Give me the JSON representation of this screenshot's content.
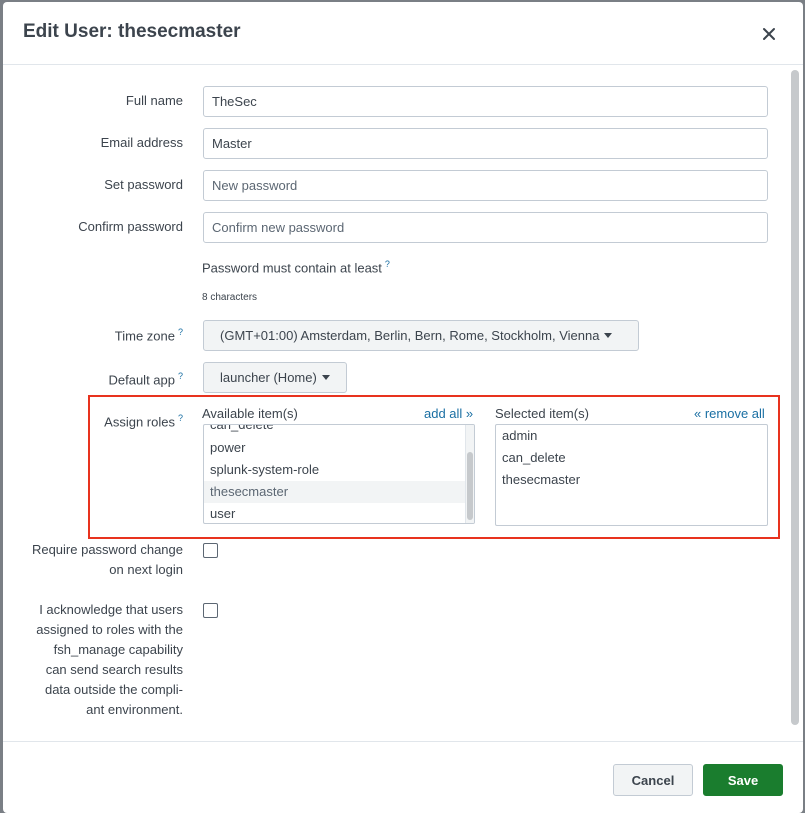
{
  "header": {
    "title": "Edit User: thesecmaster",
    "close_symbol": "×"
  },
  "form": {
    "full_name": {
      "label": "Full name",
      "value": "TheSec"
    },
    "email": {
      "label": "Email address",
      "value": "Master"
    },
    "set_password": {
      "label": "Set password",
      "placeholder": "New password"
    },
    "confirm_password": {
      "label": "Confirm password",
      "placeholder": "Confirm new password"
    },
    "password_hint": {
      "text": "Password must contain at least",
      "help": "?",
      "detail": "8 characters"
    },
    "time_zone": {
      "label": "Time zone",
      "help": "?",
      "value": "(GMT+01:00) Amsterdam, Berlin, Bern, Rome, Stockholm, Vienna"
    },
    "default_app": {
      "label": "Default app",
      "help": "?",
      "value": "launcher (Home)"
    },
    "assign_roles": {
      "label": "Assign roles",
      "help": "?",
      "available_header": "Available item(s)",
      "add_all": "add all »",
      "selected_header": "Selected item(s)",
      "remove_all": "« remove all",
      "available": [
        "can_delete",
        "power",
        "splunk-system-role",
        "thesecmaster",
        "user"
      ],
      "selected": [
        "admin",
        "can_delete",
        "thesecmaster"
      ]
    },
    "require_password_change": {
      "label_line1": "Require password change",
      "label_line2": "on next login",
      "checked": false
    },
    "acknowledge": {
      "lines": [
        "I acknowledge that users",
        "assigned to roles with the",
        "fsh_manage capability",
        "can send search results",
        "data outside the compli-",
        "ant environment."
      ],
      "checked": false
    }
  },
  "footer": {
    "cancel_label": "Cancel",
    "save_label": "Save"
  },
  "colors": {
    "save_button": "#1a7d2e",
    "link": "#1a6fa3",
    "highlight_border": "#e8321e"
  }
}
